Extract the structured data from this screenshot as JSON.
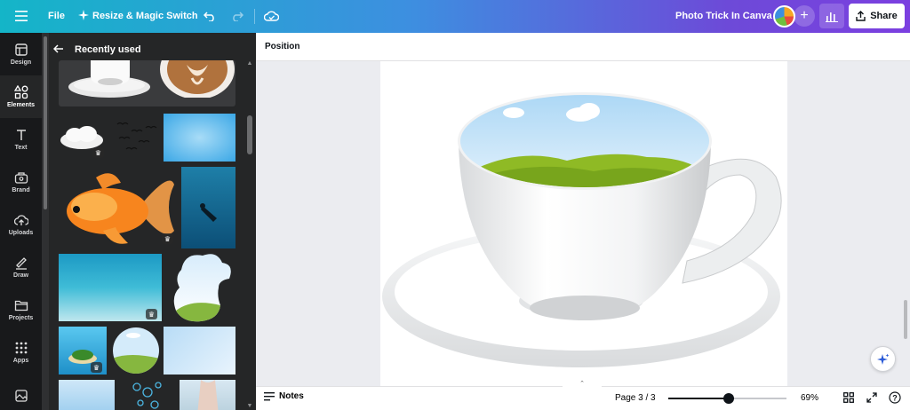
{
  "topbar": {
    "file_label": "File",
    "resize_label": "Resize & Magic Switch",
    "title": "Photo Trick In Canva",
    "share_label": "Share"
  },
  "rail": {
    "items": [
      {
        "label": "Design",
        "icon": "design-icon"
      },
      {
        "label": "Elements",
        "icon": "elements-icon",
        "active": true
      },
      {
        "label": "Text",
        "icon": "text-icon"
      },
      {
        "label": "Brand",
        "icon": "brand-icon"
      },
      {
        "label": "Uploads",
        "icon": "uploads-icon"
      },
      {
        "label": "Draw",
        "icon": "draw-icon"
      },
      {
        "label": "Projects",
        "icon": "projects-icon"
      },
      {
        "label": "Apps",
        "icon": "apps-icon"
      }
    ]
  },
  "panel": {
    "header": "Recently used",
    "thumbnails": [
      {
        "name": "cup-saucer",
        "premium": false
      },
      {
        "name": "latte-art",
        "premium": false
      },
      {
        "name": "cloud",
        "premium": true
      },
      {
        "name": "birds",
        "premium": false
      },
      {
        "name": "sky-gradient",
        "premium": false
      },
      {
        "name": "goldfish",
        "premium": true
      },
      {
        "name": "underwater-diver",
        "premium": false
      },
      {
        "name": "ocean-floor",
        "premium": true
      },
      {
        "name": "cloud-landscape-frame",
        "premium": false
      },
      {
        "name": "tropical-island",
        "premium": true
      },
      {
        "name": "circle-landscape-frame",
        "premium": false
      },
      {
        "name": "light-sky-gradient",
        "premium": false
      },
      {
        "name": "sky-partial",
        "premium": false
      },
      {
        "name": "bubbles",
        "premium": false
      },
      {
        "name": "hand-photo",
        "premium": false
      }
    ]
  },
  "context_bar": {
    "position_label": "Position"
  },
  "bottombar": {
    "notes_label": "Notes",
    "page_label": "Page 3 / 3",
    "zoom_percent": 69,
    "zoom_label": "69%"
  },
  "colors": {
    "gradient_start": "#14b5c8",
    "gradient_end": "#7b3fe0",
    "rail_bg": "#18191b",
    "panel_bg": "#252627"
  }
}
